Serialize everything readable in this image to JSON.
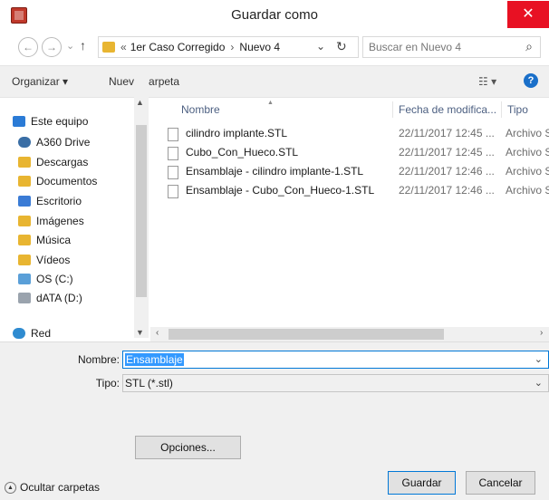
{
  "window": {
    "title": "Guardar como",
    "close_label": "✕"
  },
  "nav": {
    "back_label": "←",
    "forward_label": "→",
    "recent_label": "⌄",
    "up_label": "↑",
    "breadcrumb_prefix": "«",
    "breadcrumb": [
      "1er Caso Corregido",
      "Nuevo 4"
    ],
    "breadcrumb_sep": "›",
    "dropdown_label": "⌄",
    "refresh_label": "↻",
    "search_placeholder": "Buscar en Nuevo 4",
    "search_icon": "⌕"
  },
  "toolbar": {
    "organize_label": "Organizar ▾",
    "new_folder_label": "Nueva carpeta",
    "view_label": "☷ ▾",
    "help_label": "?"
  },
  "sidebar": {
    "items": [
      {
        "label": "Este equipo",
        "icon": "computer-icon",
        "color": "#2b7bd6"
      },
      {
        "label": "A360 Drive",
        "icon": "cloud-icon",
        "color": "#3a6ea5"
      },
      {
        "label": "Descargas",
        "icon": "downloads-folder-icon",
        "color": "#e8b531"
      },
      {
        "label": "Documentos",
        "icon": "documents-folder-icon",
        "color": "#e8b531"
      },
      {
        "label": "Escritorio",
        "icon": "desktop-folder-icon",
        "color": "#3a7bd5"
      },
      {
        "label": "Imágenes",
        "icon": "images-folder-icon",
        "color": "#e8b531"
      },
      {
        "label": "Música",
        "icon": "music-folder-icon",
        "color": "#e8b531"
      },
      {
        "label": "Vídeos",
        "icon": "videos-folder-icon",
        "color": "#e8b531"
      },
      {
        "label": "OS (C:)",
        "icon": "drive-c-icon",
        "color": "#5a9fd8"
      },
      {
        "label": "dATA (D:)",
        "icon": "drive-d-icon",
        "color": "#9aa3ad"
      },
      {
        "label": "Red",
        "icon": "network-icon",
        "color": "#2f8bd0"
      }
    ]
  },
  "columns": {
    "name": "Nombre",
    "date": "Fecha de modifica...",
    "type": "Tipo"
  },
  "files": [
    {
      "name": "cilindro implante.STL",
      "date": "22/11/2017 12:45 ...",
      "type": "Archivo S"
    },
    {
      "name": "Cubo_Con_Hueco.STL",
      "date": "22/11/2017 12:45 ...",
      "type": "Archivo S"
    },
    {
      "name": "Ensamblaje - cilindro implante-1.STL",
      "date": "22/11/2017 12:46 ...",
      "type": "Archivo S"
    },
    {
      "name": "Ensamblaje - Cubo_Con_Hueco-1.STL",
      "date": "22/11/2017 12:46 ...",
      "type": "Archivo S"
    }
  ],
  "form": {
    "name_label": "Nombre:",
    "name_value": "Ensamblaje",
    "type_label": "Tipo:",
    "type_value": "STL (*.stl)",
    "options_label": "Opciones...",
    "hide_folders_label": "Ocultar carpetas",
    "save_label": "Guardar",
    "cancel_label": "Cancelar"
  },
  "colors": {
    "accent": "#0078d7",
    "close": "#e81123",
    "selection": "#3399ff"
  }
}
